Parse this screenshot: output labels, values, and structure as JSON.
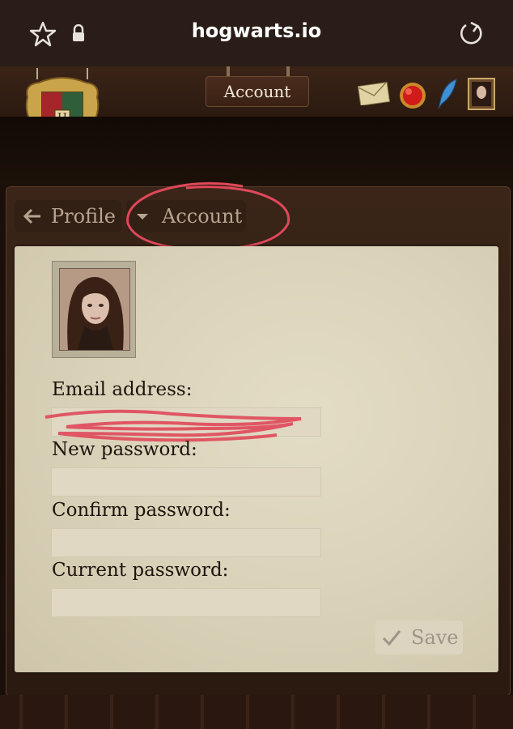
{
  "browser": {
    "url": "hogwarts.io"
  },
  "header": {
    "active_tab": "Account",
    "icons": [
      "letter-icon",
      "red-orb-icon",
      "quill-icon",
      "portrait-icon"
    ]
  },
  "nav": {
    "back_label": "Profile",
    "current_label": "Account"
  },
  "account_form": {
    "email_label": "Email address:",
    "email_value": "",
    "new_password_label": "New password:",
    "new_password_value": "",
    "confirm_password_label": "Confirm password:",
    "confirm_password_value": "",
    "current_password_label": "Current password:",
    "current_password_value": "",
    "save_label": "Save"
  },
  "colors": {
    "parchment": "#d8d0b6",
    "wood": "#3a2518",
    "annotation": "#e0485a"
  }
}
